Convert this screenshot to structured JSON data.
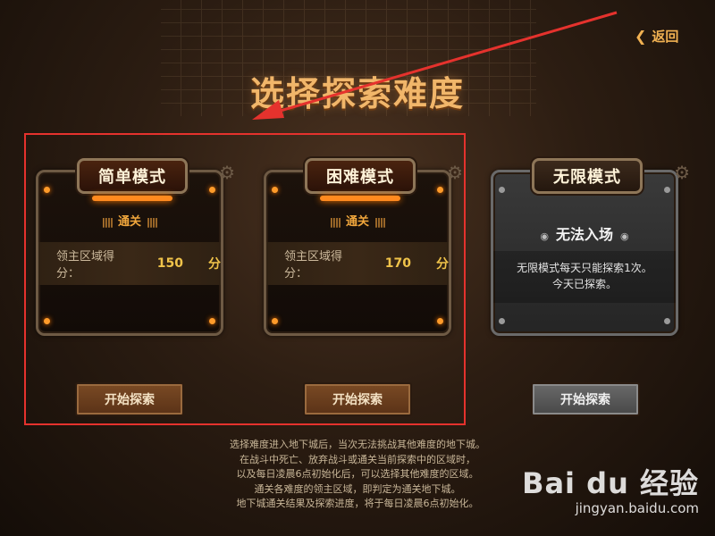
{
  "header": {
    "back_label": "返回",
    "title": "选择探索难度"
  },
  "modes": [
    {
      "name": "简单模式",
      "status": "通关",
      "score_label": "领主区域得分：",
      "score_value": "150",
      "score_unit": "分",
      "start_label": "开始探索"
    },
    {
      "name": "困难模式",
      "status": "通关",
      "score_label": "领主区域得分：",
      "score_value": "170",
      "score_unit": "分",
      "start_label": "开始探索"
    },
    {
      "name": "无限模式",
      "locked_title": "无法入场",
      "locked_line1": "无限模式每天只能探索1次。",
      "locked_line2": "今天已探索。",
      "start_label": "开始探索"
    }
  ],
  "notes": [
    "选择难度进入地下城后，当次无法挑战其他难度的地下城。",
    "在战斗中死亡、放弃战斗或通关当前探索中的区域时，",
    "以及每日凌晨6点初始化后，可以选择其他难度的区域。",
    "通关各难度的领主区域，即判定为通关地下城。",
    "地下城通关结果及探索进度，将于每日凌晨6点初始化。"
  ],
  "watermark": {
    "logo": "Bai du 经验",
    "url": "jingyan.baidu.com"
  },
  "colors": {
    "highlight_box": "#e5322d",
    "title": "#f1b66a",
    "accent": "#f0a63c"
  },
  "icons": {
    "back": "chevron-left-icon",
    "gear": "gear-icon",
    "bolt": "bolt-icon",
    "arrow": "red-arrow-annotation"
  }
}
